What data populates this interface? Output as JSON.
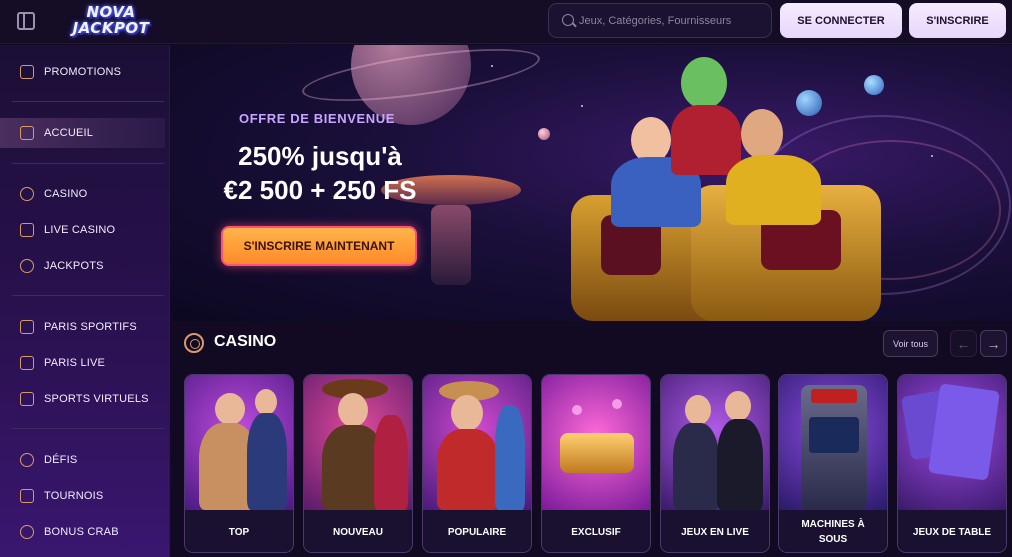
{
  "header": {
    "logo_line1": "NOVA",
    "logo_line2": "JACKPOT",
    "search_placeholder": "Jeux, Catégories, Fournisseurs",
    "login_label": "SE CONNECTER",
    "signup_label": "S'INSCRIRE"
  },
  "sidebar": {
    "items": [
      {
        "label": "PROMOTIONS",
        "icon": "gift-icon"
      },
      {
        "label": "ACCUEIL",
        "icon": "home-icon",
        "active": true
      },
      {
        "label": "CASINO",
        "icon": "chip-icon"
      },
      {
        "label": "LIVE CASINO",
        "icon": "spade-icon"
      },
      {
        "label": "JACKPOTS",
        "icon": "seven-icon"
      },
      {
        "label": "PARIS SPORTIFS",
        "icon": "trophy-icon"
      },
      {
        "label": "PARIS LIVE",
        "icon": "play-icon"
      },
      {
        "label": "SPORTS VIRTUELS",
        "icon": "gamepad-icon"
      },
      {
        "label": "DÉFIS",
        "icon": "medal-icon"
      },
      {
        "label": "TOURNOIS",
        "icon": "cup-icon"
      },
      {
        "label": "BONUS CRAB",
        "icon": "coin-icon"
      }
    ]
  },
  "banner": {
    "offer_label": "OFFRE DE BIENVENUE",
    "offer_line1": "250% jusqu'à",
    "offer_line2": "€2 500 + 250 FS",
    "cta_label": "S'INSCRIRE MAINTENANT"
  },
  "casino_section": {
    "title": "CASINO",
    "view_all_label": "Voir tous",
    "prev_arrow": "←",
    "next_arrow": "→",
    "cards": [
      {
        "label": "TOP"
      },
      {
        "label": "NOUVEAU"
      },
      {
        "label": "POPULAIRE"
      },
      {
        "label": "EXCLUSIF"
      },
      {
        "label": "JEUX EN LIVE"
      },
      {
        "label": "MACHINES À SOUS"
      },
      {
        "label": "JEUX DE TABLE"
      }
    ]
  },
  "colors": {
    "background": "#120a22",
    "accent_orange": "#ff8a2a",
    "accent_pink": "#ff4f7a",
    "icon_orange": "#d99a6a",
    "button_light": "#f6ecff"
  }
}
